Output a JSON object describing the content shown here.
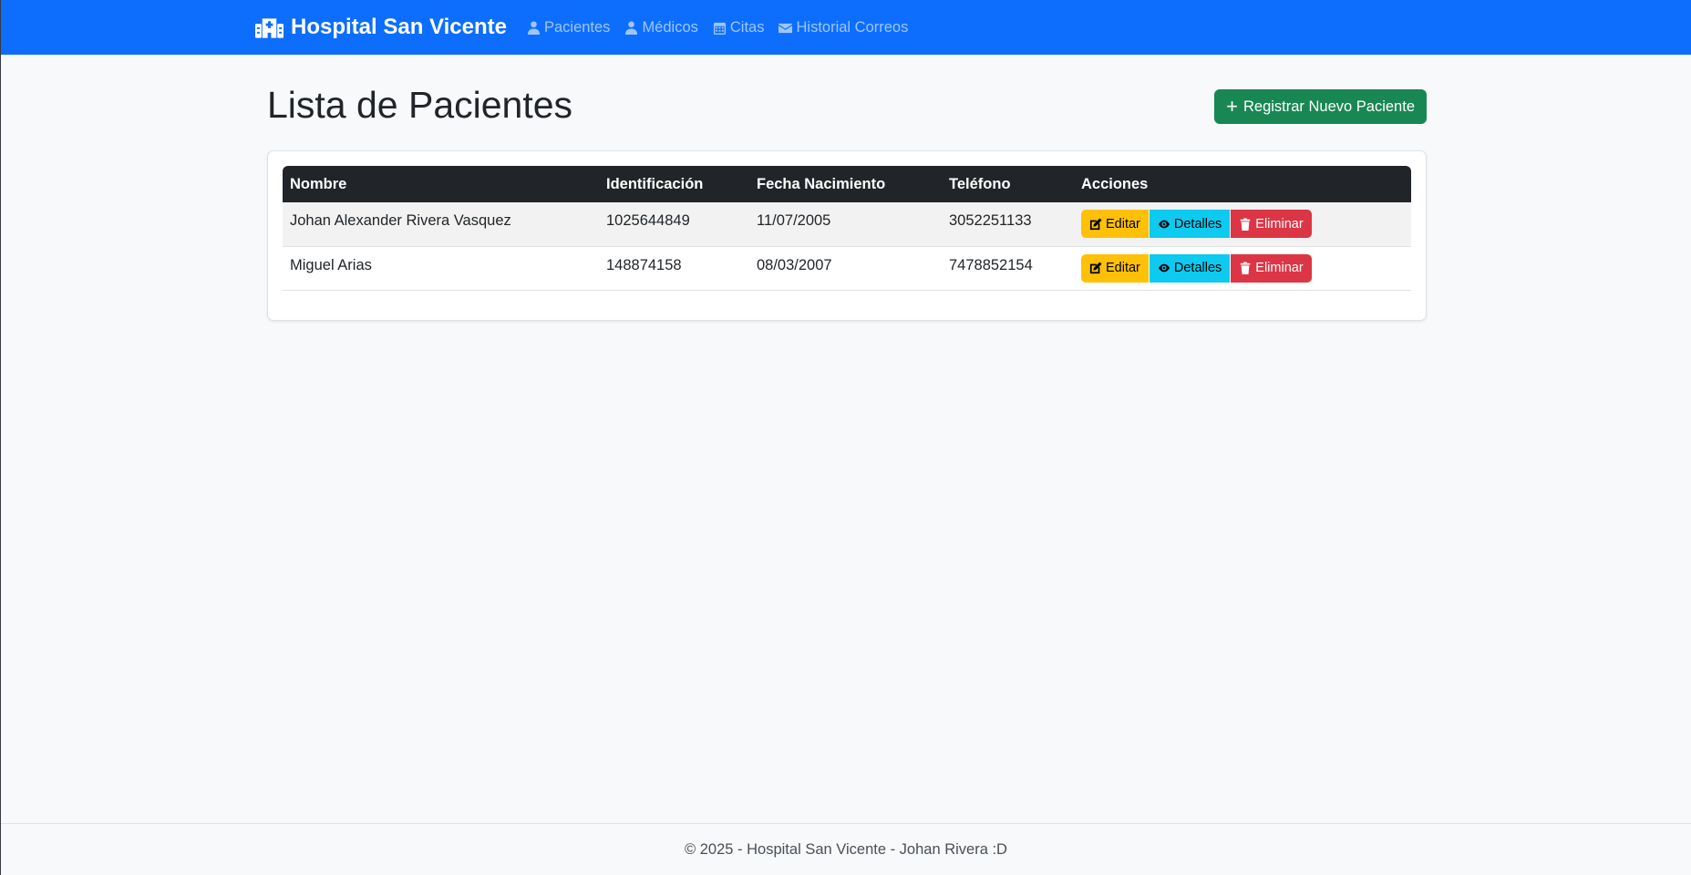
{
  "navbar": {
    "brand": "Hospital San Vicente",
    "links": [
      {
        "label": "Pacientes",
        "icon": "user-injured-icon"
      },
      {
        "label": "Médicos",
        "icon": "user-doctor-icon"
      },
      {
        "label": "Citas",
        "icon": "calendar-icon"
      },
      {
        "label": "Historial Correos",
        "icon": "envelope-icon"
      }
    ]
  },
  "page": {
    "title": "Lista de Pacientes",
    "new_button": "Registrar Nuevo Paciente"
  },
  "table": {
    "headers": [
      "Nombre",
      "Identificación",
      "Fecha Nacimiento",
      "Teléfono",
      "Acciones"
    ],
    "rows": [
      {
        "nombre": "Johan Alexander Rivera Vasquez",
        "identificacion": "1025644849",
        "fecha": "11/07/2005",
        "telefono": "3052251133"
      },
      {
        "nombre": "Miguel Arias",
        "identificacion": "148874158",
        "fecha": "08/03/2007",
        "telefono": "7478852154"
      }
    ],
    "actions": {
      "edit": "Editar",
      "details": "Detalles",
      "delete": "Eliminar"
    }
  },
  "footer": {
    "text": "© 2025 - Hospital San Vicente - Johan Rivera :D"
  },
  "colors": {
    "primary": "#0d6efd",
    "success": "#198754",
    "warning": "#ffc107",
    "info": "#0dcaf0",
    "danger": "#dc3545",
    "dark": "#212529"
  }
}
